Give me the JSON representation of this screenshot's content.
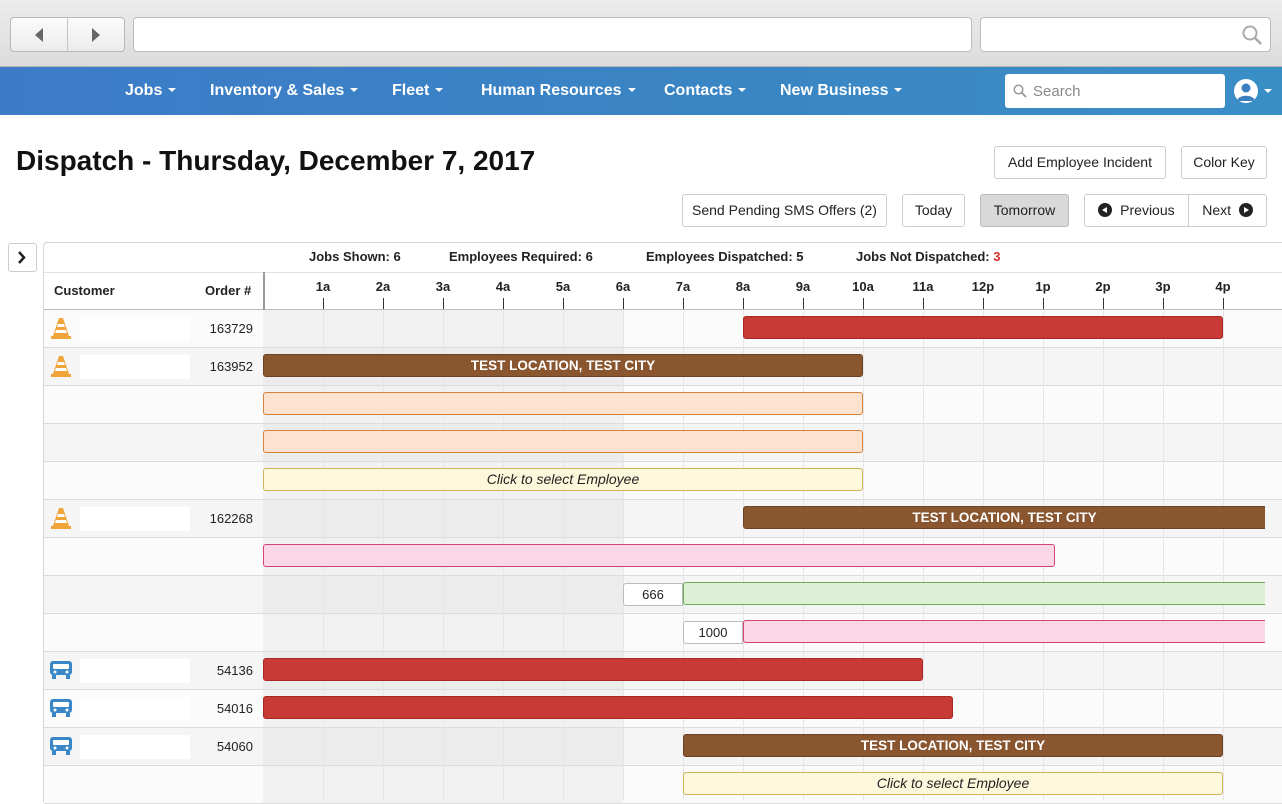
{
  "browser": {
    "search_icon": "search-icon"
  },
  "nav": {
    "menus": [
      "Jobs",
      "Inventory & Sales",
      "Fleet",
      "Human Resources",
      "Contacts",
      "New Business"
    ],
    "search_placeholder": "Search"
  },
  "page": {
    "title": "Dispatch - Thursday, December 7, 2017",
    "add_incident": "Add Employee Incident",
    "color_key": "Color Key",
    "send_sms": "Send Pending SMS Offers (2)",
    "today": "Today",
    "tomorrow": "Tomorrow",
    "previous": "Previous",
    "next": "Next"
  },
  "stats": {
    "jobs_shown_label": "Jobs Shown:",
    "jobs_shown": "6",
    "emp_required_label": "Employees Required:",
    "emp_required": "6",
    "emp_dispatched_label": "Employees Dispatched:",
    "emp_dispatched": "5",
    "not_dispatched_label": "Jobs Not Dispatched:",
    "not_dispatched": "3"
  },
  "columns": {
    "customer": "Customer",
    "order": "Order #"
  },
  "hours": [
    "1a",
    "2a",
    "3a",
    "4a",
    "5a",
    "6a",
    "7a",
    "8a",
    "9a",
    "10a",
    "11a",
    "12p",
    "1p",
    "2p",
    "3p",
    "4p"
  ],
  "rows": [
    {
      "icon": "traffic-cone-icon",
      "order": "163729",
      "bar": {
        "kind": "red",
        "start": 8,
        "end": 16,
        "label": ""
      }
    },
    {
      "icon": "traffic-cone-icon",
      "order": "163952",
      "bar": {
        "kind": "brown",
        "start": 0,
        "end": 10,
        "label": "TEST LOCATION, TEST CITY"
      }
    },
    {
      "icon": "",
      "order": "",
      "bar": {
        "kind": "peach",
        "start": 0,
        "end": 10,
        "label": ""
      }
    },
    {
      "icon": "",
      "order": "",
      "bar": {
        "kind": "peach",
        "start": 0,
        "end": 10,
        "label": ""
      }
    },
    {
      "icon": "",
      "order": "",
      "bar": {
        "kind": "cream",
        "start": 0,
        "end": 10,
        "label": "Click to select Employee"
      }
    },
    {
      "icon": "traffic-cone-icon",
      "order": "162268",
      "bar": {
        "kind": "brown",
        "start": 8,
        "end": 16.7,
        "label": "TEST LOCATION, TEST CITY",
        "open": true
      }
    },
    {
      "icon": "",
      "order": "",
      "bar": {
        "kind": "pink",
        "start": 0,
        "end": 13.2,
        "label": ""
      }
    },
    {
      "icon": "",
      "order": "",
      "count": "666",
      "bar": {
        "kind": "green",
        "start": 7,
        "end": 16.7,
        "label": "",
        "open": true
      }
    },
    {
      "icon": "",
      "order": "",
      "count": "1000",
      "bar": {
        "kind": "pink",
        "start": 8,
        "end": 16.7,
        "label": "",
        "open": true
      }
    },
    {
      "icon": "truck-icon",
      "order": "54136",
      "bar": {
        "kind": "red",
        "start": 0,
        "end": 11,
        "label": ""
      }
    },
    {
      "icon": "truck-icon",
      "order": "54016",
      "bar": {
        "kind": "red",
        "start": 0,
        "end": 11.5,
        "label": ""
      }
    },
    {
      "icon": "truck-icon",
      "order": "54060",
      "bar": {
        "kind": "brown",
        "start": 7,
        "end": 16,
        "label": "TEST LOCATION, TEST CITY"
      }
    },
    {
      "icon": "",
      "order": "",
      "bar": {
        "kind": "cream",
        "start": 7,
        "end": 16,
        "label": "Click to select Employee"
      }
    }
  ]
}
